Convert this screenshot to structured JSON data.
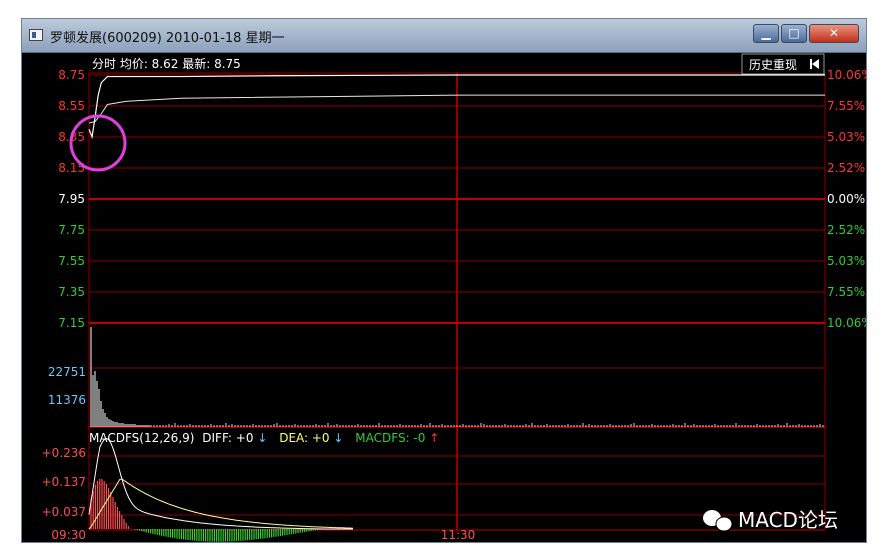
{
  "window": {
    "title": "罗顿发展(600209) 2010-01-18 星期一",
    "controls": {
      "minimize": "▁",
      "maximize": "□",
      "close": "✕"
    }
  },
  "header": {
    "info": "分时 均价: 8.62 最新: 8.75",
    "replay_button": "历史重现",
    "replay_icon": "skip-back-icon"
  },
  "price_axis": {
    "left_labels": [
      "8.75",
      "8.55",
      "8.35",
      "8.15",
      "7.95",
      "7.75",
      "7.55",
      "7.35",
      "7.15"
    ],
    "right_labels": [
      "10.06%",
      "7.55%",
      "5.03%",
      "2.52%",
      "0.00%",
      "2.52%",
      "5.03%",
      "7.55%",
      "10.06%"
    ]
  },
  "volume_axis": {
    "labels": [
      "22751",
      "11376"
    ]
  },
  "macd": {
    "legend": {
      "name": "MACDFS(12,26,9)",
      "diff": "DIFF: +0",
      "dea": "DEA: +0",
      "macdfs": "MACDFS: -0"
    },
    "labels": [
      "+0.236",
      "+0.137",
      "+0.037"
    ]
  },
  "time_axis": {
    "start": "09:30",
    "mid": "11:30"
  },
  "watermark": "MACD论坛",
  "colors": {
    "grid": "#8a0000",
    "price_up": "#ff3333",
    "price_down": "#33cc33",
    "label_white": "#ffffff",
    "volume_label": "#66c8ff",
    "macd_red": "#ff4d4d",
    "macd_green": "#33cc33",
    "highlight_circle": "#e040e0"
  },
  "chart_data": {
    "type": "line",
    "price_series": {
      "y_range": [
        7.15,
        8.75
      ],
      "points_minutes_close": [
        [
          0,
          8.4
        ],
        [
          1,
          8.35
        ],
        [
          2,
          8.48
        ],
        [
          3,
          8.62
        ],
        [
          4,
          8.7
        ],
        [
          6,
          8.74
        ],
        [
          10,
          8.74
        ],
        [
          30,
          8.74
        ],
        [
          60,
          8.745
        ],
        [
          120,
          8.75
        ],
        [
          155,
          8.75
        ],
        [
          240,
          8.75
        ]
      ],
      "avg_points": [
        [
          0,
          8.44
        ],
        [
          2,
          8.45
        ],
        [
          4,
          8.5
        ],
        [
          6,
          8.56
        ],
        [
          12,
          8.58
        ],
        [
          30,
          8.6
        ],
        [
          120,
          8.62
        ],
        [
          240,
          8.62
        ]
      ]
    },
    "volume_series": {
      "max": 22751
    },
    "macd_series": {
      "y_range": [
        -0.06,
        0.236
      ]
    }
  }
}
